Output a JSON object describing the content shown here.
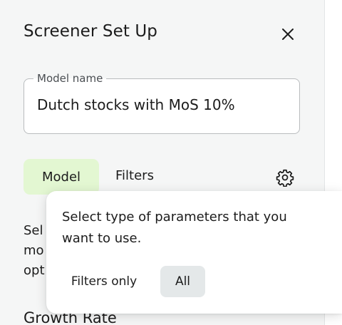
{
  "panel": {
    "title": "Screener Set Up",
    "close_icon": "close-icon"
  },
  "model_name": {
    "label": "Model name",
    "value": "Dutch stocks with MoS 10%"
  },
  "tabs": [
    {
      "label": "Model",
      "active": true
    },
    {
      "label": "Filters",
      "active": false
    }
  ],
  "settings_icon": "gear-icon",
  "description": {
    "lines": [
      "Sel",
      "mo",
      "opt"
    ]
  },
  "section": {
    "heading": "Growth Rate"
  },
  "popover": {
    "text": "Select type of parameters that you want to use.",
    "options": [
      {
        "label": "Filters only",
        "selected": false
      },
      {
        "label": "All",
        "selected": true
      }
    ]
  },
  "colors": {
    "active_tab_bg": "#e3f7d2",
    "selected_option_bg": "#e4e8e9",
    "panel_bg": "#f5f6f6"
  }
}
